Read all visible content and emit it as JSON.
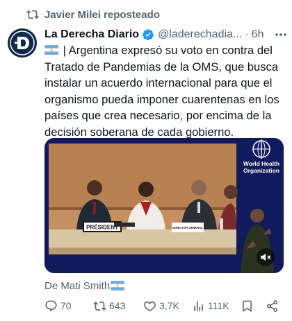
{
  "repost": {
    "label": "Javier Milei reposteado"
  },
  "tweet": {
    "display_name": "La Derecha Diario",
    "handle": "@laderechadia...",
    "separator": "·",
    "time": "6h",
    "text": "| Argentina expresó su voto en contra del Tratado de Pandemias de la OMS, que busca instalar un acuerdo internacional para que el organismo pueda imponer cuarentenas en los países que crea necesario, por encima de la decisión soberana de cada gobierno.",
    "credit": "De Mati Smith"
  },
  "media": {
    "who_line1": "World Health",
    "who_line2": "Organization",
    "placard_president": "PRÉSIDENT",
    "placard_director": "DIRECTOR GENERAL"
  },
  "actions": {
    "replies": "70",
    "reposts": "643",
    "likes": "3,7K",
    "views": "111K"
  },
  "colors": {
    "text": "#0f1419",
    "secondary": "#536471",
    "verified": "#1d9bf0",
    "media_panel": "#101a5c"
  }
}
